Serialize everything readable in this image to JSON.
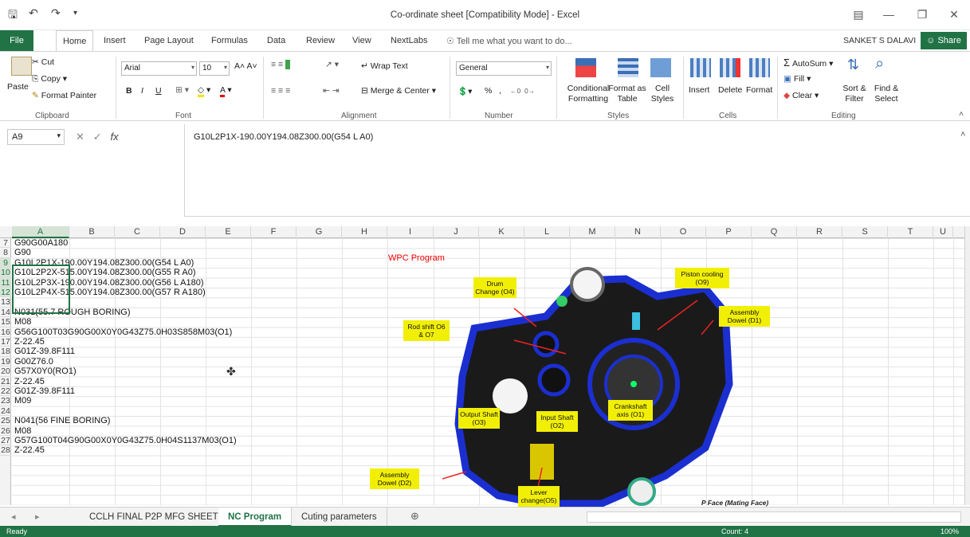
{
  "window": {
    "title": "Co-ordinate sheet  [Compatibility Mode] - Excel",
    "user": "SANKET S DALAVI",
    "share": "Share"
  },
  "tabs": [
    "File",
    "Home",
    "Insert",
    "Page Layout",
    "Formulas",
    "Data",
    "Review",
    "View",
    "NextLabs"
  ],
  "tell_me": "Tell me what you want to do...",
  "ribbon": {
    "clipboard": {
      "paste": "Paste",
      "cut": "Cut",
      "copy": "Copy",
      "format_painter": "Format Painter",
      "label": "Clipboard"
    },
    "font": {
      "name": "Arial",
      "size": "10",
      "bold": "B",
      "italic": "I",
      "underline": "U",
      "label": "Font"
    },
    "alignment": {
      "wrap_text": "Wrap Text",
      "merge_center": "Merge & Center",
      "label": "Alignment"
    },
    "number": {
      "format": "General",
      "percent": "%",
      "comma": ",",
      "label": "Number"
    },
    "styles": {
      "conditional": "Conditional Formatting",
      "format_table": "Format as Table",
      "cell_styles": "Cell Styles",
      "label": "Styles"
    },
    "cells": {
      "insert": "Insert",
      "delete": "Delete",
      "format": "Format",
      "label": "Cells"
    },
    "editing": {
      "autosum": "AutoSum",
      "fill": "Fill",
      "clear": "Clear",
      "sort_filter": "Sort & Filter",
      "find_select": "Find & Select",
      "label": "Editing"
    }
  },
  "formula_bar": {
    "name_box": "A9",
    "fx": "fx",
    "content": "G10L2P1X-190.00Y194.08Z300.00(G54 L A0)"
  },
  "columns": [
    "A",
    "B",
    "C",
    "D",
    "E",
    "F",
    "G",
    "H",
    "I",
    "J",
    "K",
    "L",
    "M",
    "N",
    "O",
    "P",
    "Q",
    "R",
    "S",
    "T",
    "U"
  ],
  "rows": [
    {
      "num": "7",
      "text": "G90G00A180"
    },
    {
      "num": "8",
      "text": "G90"
    },
    {
      "num": "9",
      "text": "G10L2P1X-190.00Y194.08Z300.00(G54 L A0)"
    },
    {
      "num": "10",
      "text": "G10L2P2X-515.00Y194.08Z300.00(G55 R A0)"
    },
    {
      "num": "11",
      "text": "G10L2P3X-190.00Y194.08Z300.00(G56 L A180)"
    },
    {
      "num": "12",
      "text": "G10L2P4X-515.00Y194.08Z300.00(G57 R A180)"
    },
    {
      "num": "13",
      "text": ""
    },
    {
      "num": "14",
      "text": "N031(55.7 ROUGH BORING)"
    },
    {
      "num": "15",
      "text": "M08"
    },
    {
      "num": "16",
      "text": "G56G100T03G90G00X0Y0G43Z75.0H03S858M03(O1)"
    },
    {
      "num": "17",
      "text": "Z-22.45"
    },
    {
      "num": "18",
      "text": "G01Z-39.8F111"
    },
    {
      "num": "19",
      "text": "G00Z76.0"
    },
    {
      "num": "20",
      "text": "G57X0Y0(RO1)"
    },
    {
      "num": "21",
      "text": "Z-22.45"
    },
    {
      "num": "22",
      "text": "G01Z-39.8F111"
    },
    {
      "num": "23",
      "text": "M09"
    },
    {
      "num": "24",
      "text": ""
    },
    {
      "num": "25",
      "text": "N041(56 FINE BORING)"
    },
    {
      "num": "26",
      "text": "M08"
    },
    {
      "num": "27",
      "text": "G57G100T04G90G00X0Y0G43Z75.0H04S1137M03(O1)"
    },
    {
      "num": "28",
      "text": "Z-22.45"
    }
  ],
  "drawing": {
    "title": "WPC Program",
    "notes": {
      "piston": "Piston cooling (O9)",
      "drum": "Drum Change (O4)",
      "assembly1": "Assembly Dowel (D1)",
      "rodshift": "Rod shift O6 & O7",
      "crankshaft": "Crankshaft axis (O1)",
      "output": "Output Shaft (O3)",
      "input": "Input Shaft (O2)",
      "assembly2": "Assembly Dowel (D2)",
      "lever": "Lever change(O5)"
    },
    "face_label": "P Face (Mating Face)"
  },
  "sheets": [
    "CCLH FINAL P2P MFG SHEET",
    "NC Program",
    "Cuting parameters"
  ],
  "active_sheet": "NC Program",
  "status": {
    "ready": "Ready",
    "count": "Count: 4",
    "zoom": "100%"
  }
}
